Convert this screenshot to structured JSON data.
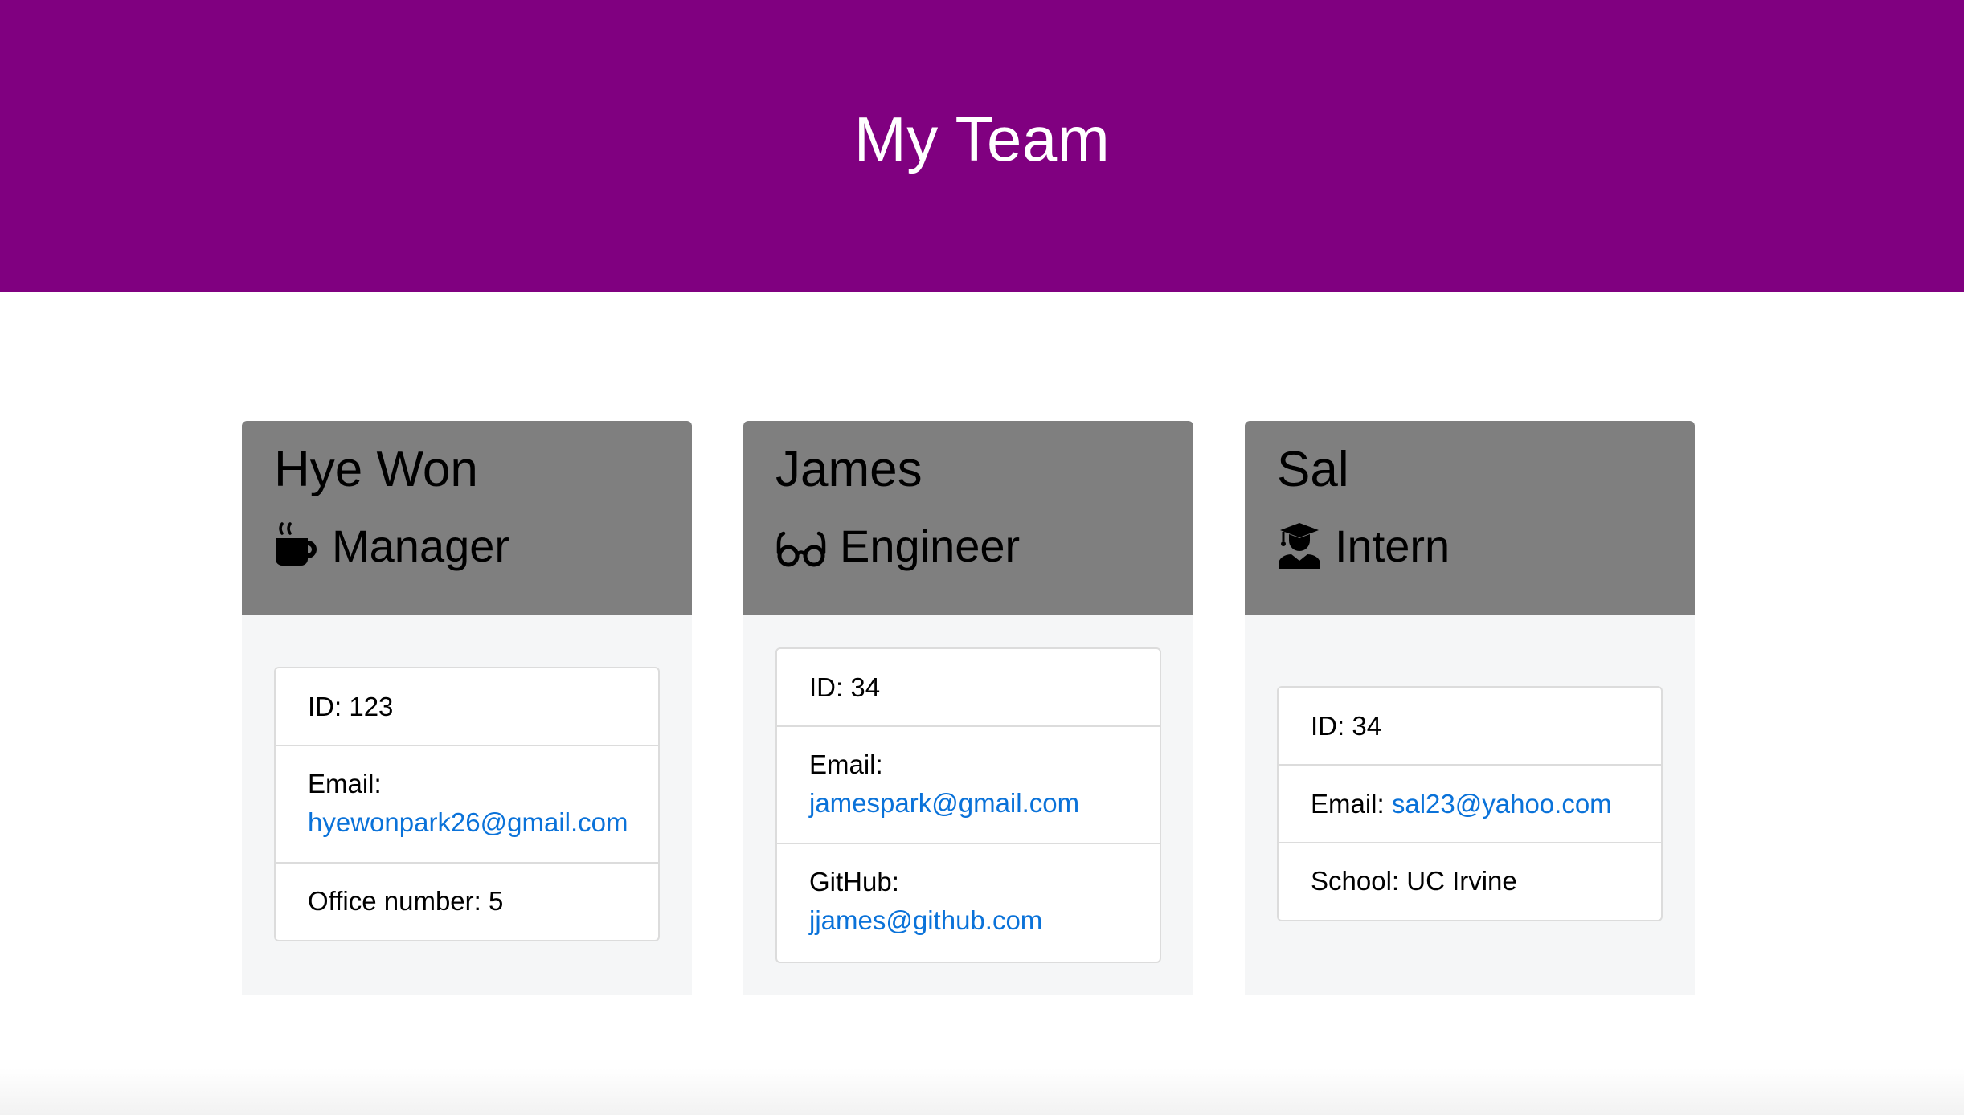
{
  "page": {
    "title": "My Team",
    "header_color": "#800080"
  },
  "employees": [
    {
      "name": "Hye Won",
      "role": "Manager",
      "role_icon": "coffee-mug-icon",
      "id_text": "ID: 123",
      "email_label": "Email:",
      "email": "hyewonpark26@gmail.com",
      "extra_text": "Office number: 5"
    },
    {
      "name": "James",
      "role": "Engineer",
      "role_icon": "glasses-icon",
      "id_text": "ID: 34",
      "email_label": "Email:",
      "email": "jamespark@gmail.com",
      "extra_label": "GitHub:",
      "extra_link": "jjames@github.com"
    },
    {
      "name": "Sal",
      "role": "Intern",
      "role_icon": "graduate-icon",
      "id_text": "ID: 34",
      "email_label": "Email:",
      "email": "sal23@yahoo.com",
      "extra_text": "School: UC Irvine"
    }
  ],
  "colors": {
    "card_header": "#7f7f7f",
    "card_body": "#f5f6f7",
    "link": "#0a72d9"
  }
}
